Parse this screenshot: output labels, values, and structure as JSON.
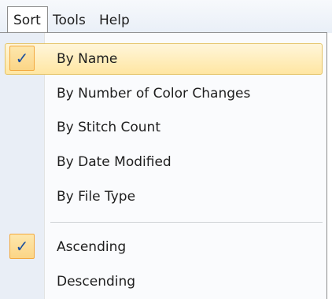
{
  "menubar": {
    "items": [
      {
        "label": "Sort",
        "open": true
      },
      {
        "label": "Tools",
        "open": false
      },
      {
        "label": "Help",
        "open": false
      }
    ]
  },
  "sort_menu": {
    "check_glyph": "✓",
    "items": [
      {
        "label": "By Name",
        "checked": true,
        "highlighted": true
      },
      {
        "label": "By Number of Color Changes",
        "checked": false,
        "highlighted": false
      },
      {
        "label": "By Stitch Count",
        "checked": false,
        "highlighted": false
      },
      {
        "label": "By Date Modified",
        "checked": false,
        "highlighted": false
      },
      {
        "label": "By File Type",
        "checked": false,
        "highlighted": false
      },
      {
        "label": "Ascending",
        "checked": true,
        "highlighted": false
      },
      {
        "label": "Descending",
        "checked": false,
        "highlighted": false
      }
    ]
  },
  "colors": {
    "checkmark": "#1b4f9e",
    "hover_border": "#e5c365",
    "check_border": "#f3a93f"
  }
}
